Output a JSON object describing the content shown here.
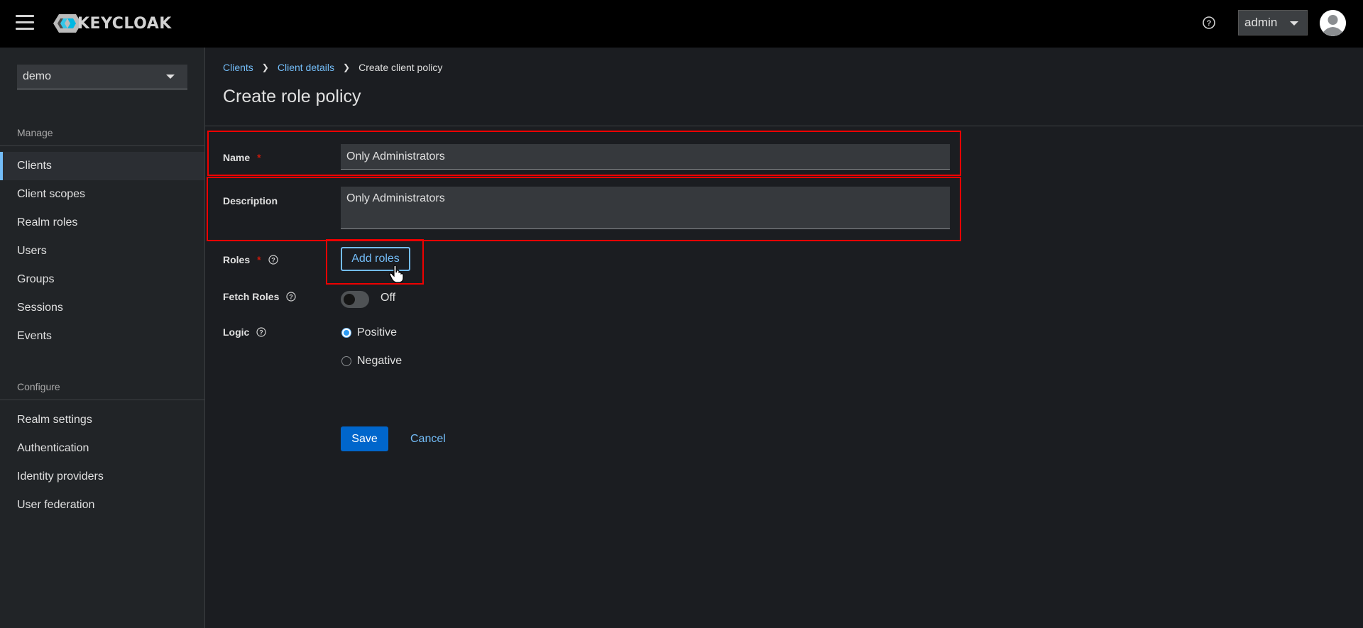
{
  "header": {
    "brand": "KEYCLOAK",
    "user_menu": "admin",
    "icons": [
      "menu-icon",
      "keycloak-logo-icon",
      "help-icon",
      "avatar-icon"
    ]
  },
  "sidebar": {
    "realm": "demo",
    "manage_title": "Manage",
    "manage_items": [
      {
        "label": "Clients",
        "active": true
      },
      {
        "label": "Client scopes"
      },
      {
        "label": "Realm roles"
      },
      {
        "label": "Users"
      },
      {
        "label": "Groups"
      },
      {
        "label": "Sessions"
      },
      {
        "label": "Events"
      }
    ],
    "configure_title": "Configure",
    "configure_items": [
      {
        "label": "Realm settings"
      },
      {
        "label": "Authentication"
      },
      {
        "label": "Identity providers"
      },
      {
        "label": "User federation"
      }
    ]
  },
  "breadcrumb": {
    "items": [
      "Clients",
      "Client details"
    ],
    "current": "Create client policy"
  },
  "page": {
    "title": "Create role policy"
  },
  "form": {
    "name_label": "Name",
    "name_value": "Only Administrators",
    "description_label": "Description",
    "description_value": "Only Administrators",
    "roles_label": "Roles",
    "add_roles_button": "Add roles",
    "fetch_roles_label": "Fetch Roles",
    "fetch_roles_state": "Off",
    "logic_label": "Logic",
    "logic_options": [
      {
        "label": "Positive",
        "selected": true
      },
      {
        "label": "Negative",
        "selected": false
      }
    ],
    "save_button": "Save",
    "cancel_button": "Cancel",
    "required_marker": "*"
  },
  "colors": {
    "accent": "#73bcf7",
    "primary": "#0066cc",
    "highlight": "#ee0000"
  }
}
